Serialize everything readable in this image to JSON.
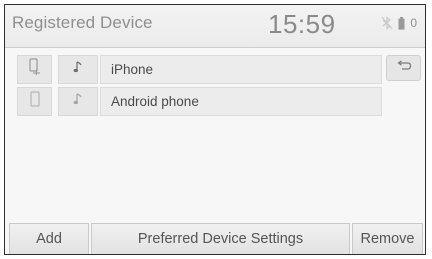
{
  "header": {
    "title": "Registered Device",
    "clock": "15:59",
    "status_icons": [
      "bluetooth-off-icon",
      "battery-icon",
      "signal-icon"
    ],
    "status_number": "0"
  },
  "devices": [
    {
      "name": "iPhone",
      "phone_icon": "phone-connected-icon",
      "audio_icon": "music-note-icon"
    },
    {
      "name": "Android phone",
      "phone_icon": "phone-icon",
      "audio_icon": "music-note-icon"
    }
  ],
  "back_icon": "return-arrow-icon",
  "footer": {
    "add_label": "Add",
    "preferred_label": "Preferred Device Settings",
    "remove_label": "Remove"
  },
  "colors": {
    "background": "#f7f7f7",
    "row_cell": "#e7e7e7",
    "text": "#4a4a4a",
    "title_text": "#8f8f8f",
    "frame": "#2f2f2f"
  }
}
